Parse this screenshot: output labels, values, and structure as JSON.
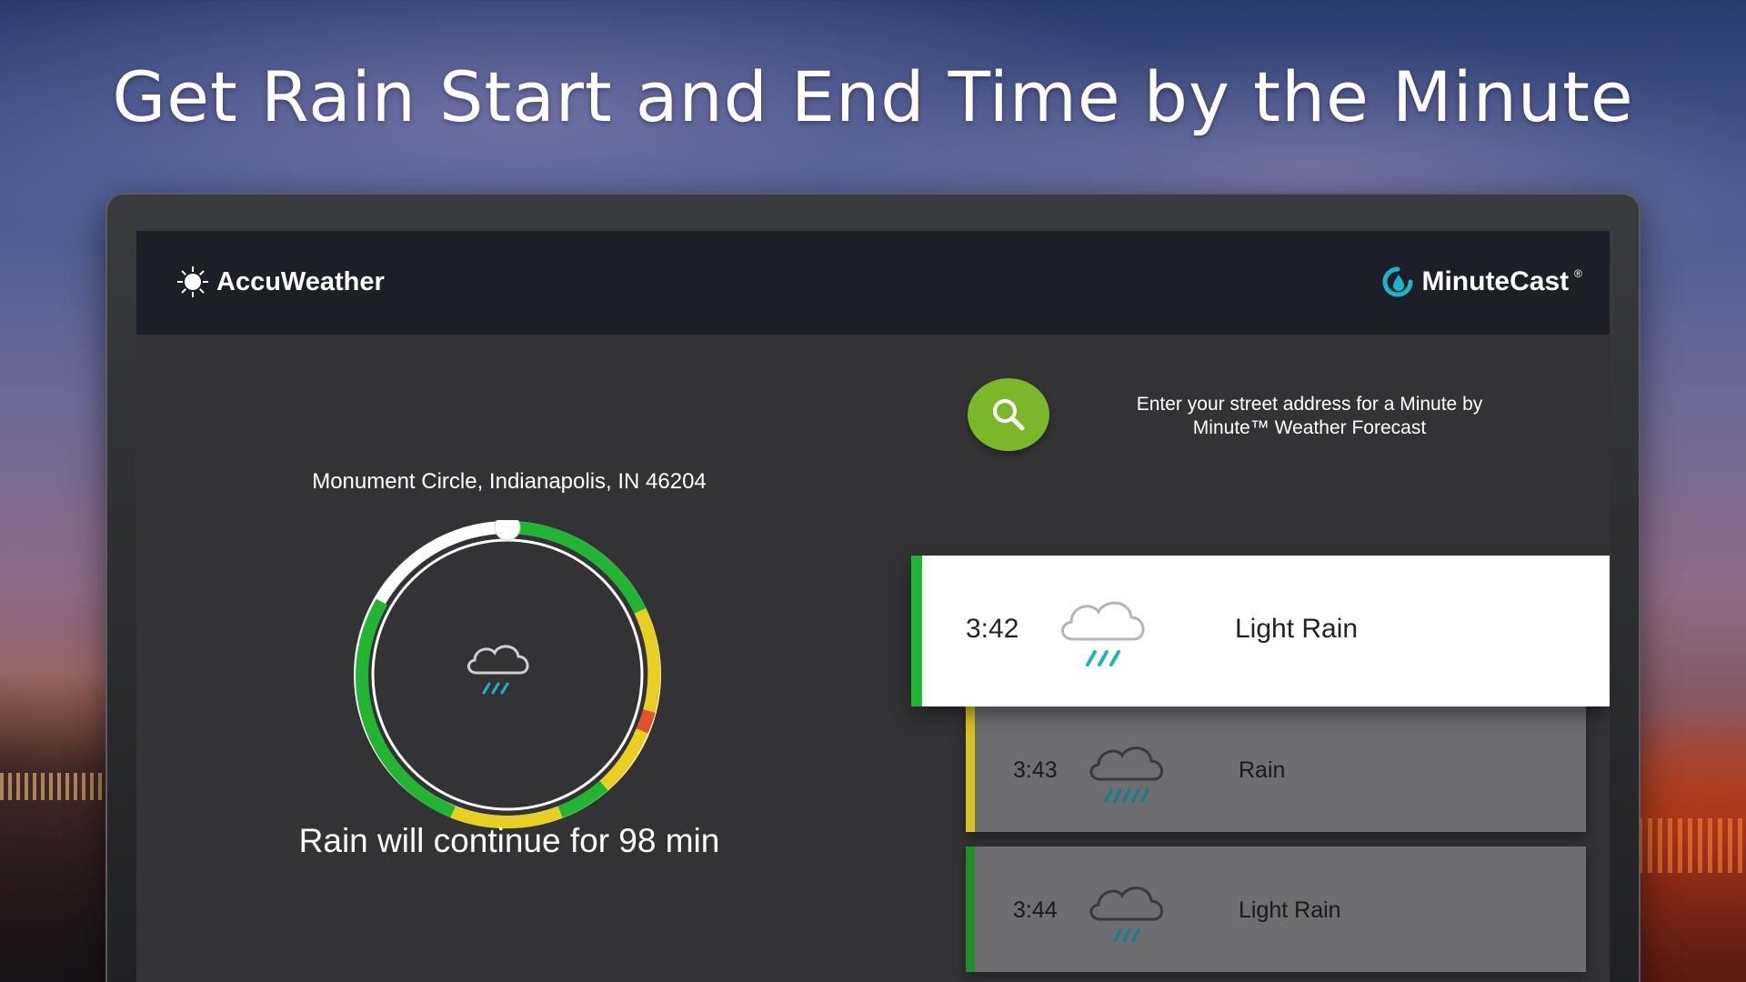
{
  "headline": "Get Rain Start and End Time by the Minute",
  "app": {
    "brand": "AccuWeather",
    "product": "MinuteCast",
    "product_mark": "®"
  },
  "location": {
    "address": "Monument Circle, Indianapolis, IN 46204"
  },
  "summary": {
    "text": "Rain will continue for 98 min"
  },
  "search": {
    "hint": "Enter your street address for a Minute by Minute™ Weather Forecast",
    "icon": "search-icon"
  },
  "forecast": [
    {
      "time": "3:42",
      "condition": "Light Rain",
      "icon": "light-rain-icon",
      "color": "#22b531"
    },
    {
      "time": "3:43",
      "condition": "Rain",
      "icon": "rain-icon",
      "color": "#d9c21e"
    },
    {
      "time": "3:44",
      "condition": "Light Rain",
      "icon": "light-rain-icon",
      "color": "#1f8f2a"
    }
  ],
  "colors": {
    "accent_green": "#7ab829",
    "light_rain": "#22b531",
    "rain": "#e8cf22",
    "heavy_rain": "#e3532b",
    "rain_drop": "#1fb3c8"
  }
}
